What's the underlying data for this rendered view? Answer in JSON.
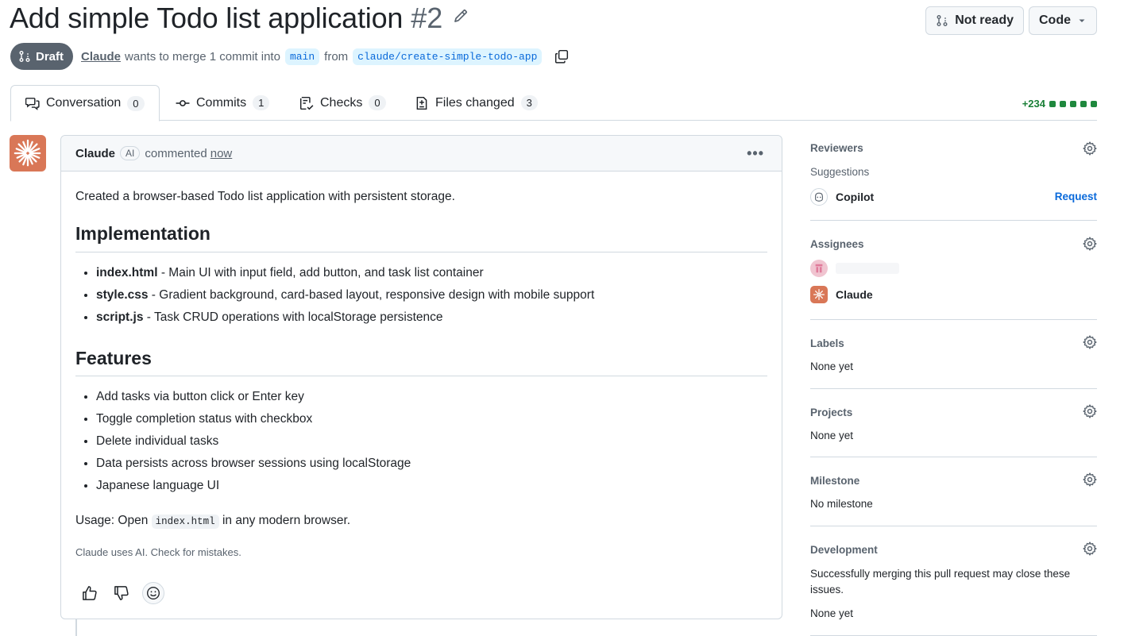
{
  "pr": {
    "title": "Add simple Todo list application",
    "number": "#2",
    "status": "Draft",
    "author": "Claude",
    "merge_text_1": "wants to merge 1 commit into",
    "base_branch": "main",
    "from_text": "from",
    "head_branch": "claude/create-simple-todo-app"
  },
  "header_buttons": {
    "not_ready": "Not ready",
    "code": "Code"
  },
  "tabs": [
    {
      "label": "Conversation",
      "count": "0"
    },
    {
      "label": "Commits",
      "count": "1"
    },
    {
      "label": "Checks",
      "count": "0"
    },
    {
      "label": "Files changed",
      "count": "3"
    }
  ],
  "diffstat": {
    "additions": "+234"
  },
  "comment": {
    "author": "Claude",
    "badge": "AI",
    "action": "commented",
    "time": "now",
    "intro": "Created a browser-based Todo list application with persistent storage.",
    "implementation_heading": "Implementation",
    "implementation_items": [
      {
        "file": "index.html",
        "desc": " - Main UI with input field, add button, and task list container"
      },
      {
        "file": "style.css",
        "desc": " - Gradient background, card-based layout, responsive design with mobile support"
      },
      {
        "file": "script.js",
        "desc": " - Task CRUD operations with localStorage persistence"
      }
    ],
    "features_heading": "Features",
    "features_items": [
      "Add tasks via button click or Enter key",
      "Toggle completion status with checkbox",
      "Delete individual tasks",
      "Data persists across browser sessions using localStorage",
      "Japanese language UI"
    ],
    "usage_prefix": "Usage: Open",
    "usage_code": "index.html",
    "usage_suffix": "in any modern browser.",
    "disclaimer": "Claude uses AI. Check for mistakes."
  },
  "sidebar": {
    "reviewers": {
      "title": "Reviewers",
      "suggestions": "Suggestions",
      "suggested": "Copilot",
      "request": "Request"
    },
    "assignees": {
      "title": "Assignees",
      "assignee": "Claude"
    },
    "labels": {
      "title": "Labels",
      "value": "None yet"
    },
    "projects": {
      "title": "Projects",
      "value": "None yet"
    },
    "milestone": {
      "title": "Milestone",
      "value": "No milestone"
    },
    "development": {
      "title": "Development",
      "description": "Successfully merging this pull request may close these issues.",
      "value": "None yet"
    }
  },
  "colors": {
    "accent": "#0969da",
    "claude_brand": "#d97757",
    "draft_badge": "#59636e",
    "additions": "#1a7f37"
  }
}
